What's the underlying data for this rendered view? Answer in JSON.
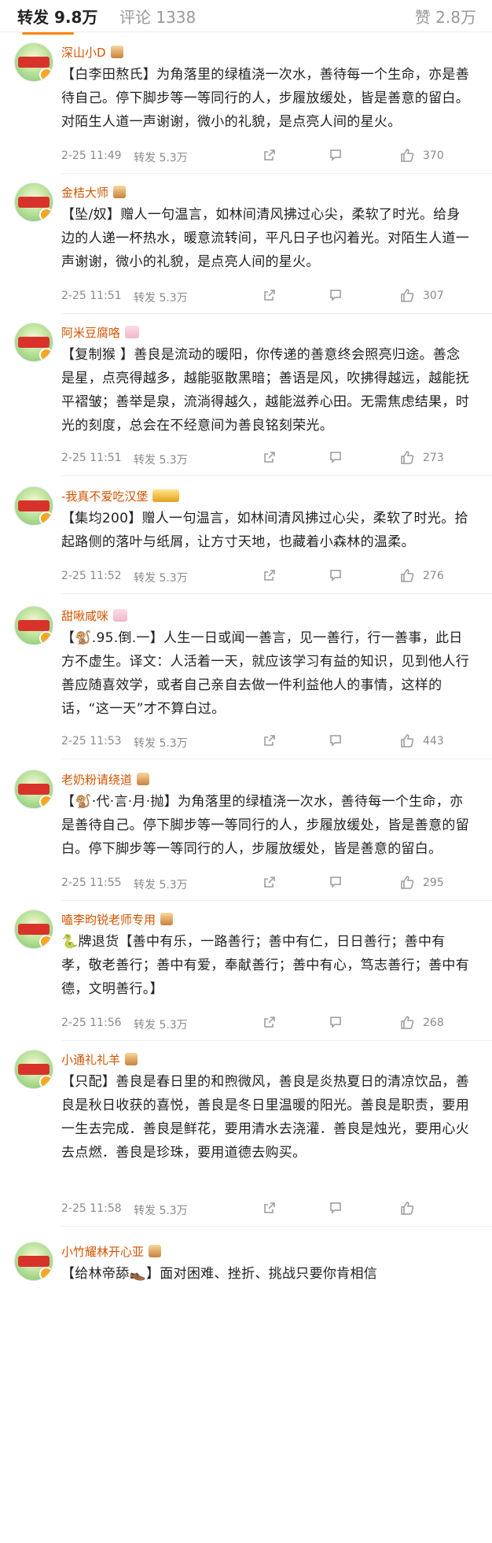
{
  "header": {
    "repost_tab": "转发 9.8万",
    "comment_tab": "评论 1338",
    "like_tab": "赞 2.8万"
  },
  "comments": [
    {
      "user": "深山小D",
      "text": "【白李田熬氏】为角落里的绿植浇一次水，善待每一个生命，亦是善待自己。停下脚步等一等同行的人，步履放缓处，皆是善意的留白。对陌生人道一声谢谢，微小的礼貌，是点亮人间的星火。",
      "time": "2-25 11:49",
      "repost": "转发 5.3万",
      "likes": "370"
    },
    {
      "user": "金桔大师",
      "text": "【坠/奴】赠人一句温言，如林间清风拂过心尖，柔软了时光。给身边的人递一杯热水，暖意流转间，平凡日子也闪着光。对陌生人道一声谢谢，微小的礼貌，是点亮人间的星火。",
      "time": "2-25 11:51",
      "repost": "转发 5.3万",
      "likes": "307"
    },
    {
      "user": "阿米豆腐咯",
      "text": "【复制猴 】善良是流动的暖阳，你传递的善意终会照亮归途。善念是星，点亮得越多，越能驱散黑暗；善语是风，吹拂得越远，越能抚平褶皱；善举是泉，流淌得越久，越能滋养心田。无需焦虑结果，时光的刻度，总会在不经意间为善良铭刻荣光。",
      "time": "2-25 11:51",
      "repost": "转发 5.3万",
      "likes": "273"
    },
    {
      "user": "-我真不爱吃汉堡",
      "text": "【集均200】赠人一句温言，如林间清风拂过心尖，柔软了时光。拾起路侧的落叶与纸屑，让方寸天地，也藏着小森林的温柔。",
      "time": "2-25 11:52",
      "repost": "转发 5.3万",
      "likes": "276"
    },
    {
      "user": "甜啾咸咪",
      "text": "【🐒.95.倒.一】人生一日或闻一善言，见一善行，行一善事，此日方不虚生。译文：人活着一天，就应该学习有益的知识，见到他人行善应随喜效学，或者自己亲自去做一件利益他人的事情，这样的话，“这一天”才不算白过。",
      "time": "2-25 11:53",
      "repost": "转发 5.3万",
      "likes": "443"
    },
    {
      "user": "老奶粉请绕道",
      "text": "【🐒·代·言·月·抛】为角落里的绿植浇一次水，善待每一个生命，亦是善待自己。停下脚步等一等同行的人，步履放缓处，皆是善意的留白。停下脚步等一等同行的人，步履放缓处，皆是善意的留白。",
      "time": "2-25 11:55",
      "repost": "转发 5.3万",
      "likes": "295"
    },
    {
      "user": "嗑李昀锐老师专用",
      "text": "🐍牌退货【善中有乐，一路善行；善中有仁，日日善行；善中有孝，敬老善行；善中有爱，奉献善行；善中有心，笃志善行；善中有德，文明善行。】",
      "time": "2-25 11:56",
      "repost": "转发 5.3万",
      "likes": "268"
    },
    {
      "user": "小通礼礼羊",
      "text": "【只配】善良是春日里的和煦微风，善良是炎热夏日的清凉饮品，善良是秋日收获的喜悦，善良是冬日里温暖的阳光。善良是职责，要用一生去完成．善良是鲜花，要用清水去浇灌．善良是烛光，要用心火去点燃．善良是珍珠，要用道德去购买。",
      "time": "2-25 11:58",
      "repost": "转发 5.3万",
      "likes": ""
    },
    {
      "user": "小竹耀林开心亚",
      "text": "【给林帝舔👞】面对困难、挫折、挑战只要你肯相信",
      "time": "",
      "repost": "",
      "likes": ""
    }
  ]
}
